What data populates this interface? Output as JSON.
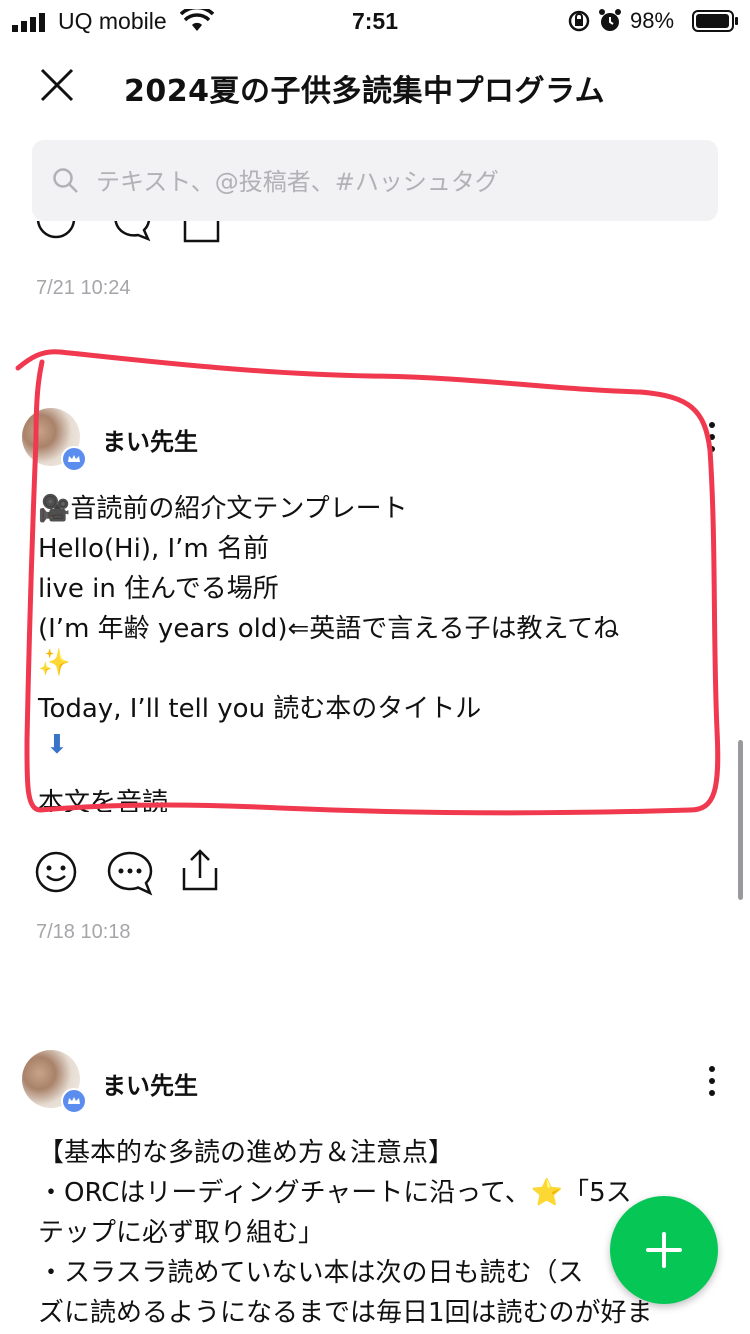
{
  "status_bar": {
    "carrier": "UQ mobile",
    "time": "7:51",
    "battery_pct": "98%"
  },
  "header": {
    "title": "2024夏の子供多読集中プログラム"
  },
  "search": {
    "placeholder": "テキスト、@投稿者、#ハッシュタグ"
  },
  "prev_post": {
    "timestamp": "7/21 10:24"
  },
  "post1": {
    "author": "まい先生",
    "lines": [
      "🎥音読前の紹介文テンプレート",
      "Hello(Hi), I’m 名前",
      " live in 住んでる場所",
      "(I’m 年齢 years old)⇐英語で言える子は教えてね",
      "✨",
      "Today, I’ll tell you 読む本のタイトル",
      "⬇",
      "本文を音読"
    ],
    "timestamp": "7/18 10:18"
  },
  "post2": {
    "author": "まい先生",
    "lines": [
      "【基本的な多読の進め方＆注意点】",
      "・ORCはリーディングチャートに沿って、⭐「5ス",
      "テップに必ず取り組む」",
      "・スラスラ読めていない本は次の日も読む（ス",
      "ズに読めるようになるまでは毎日1回は読むのが好ま"
    ]
  },
  "colors": {
    "highlight": "#f0394f",
    "fab": "#06c755",
    "badge": "#5b8def"
  }
}
